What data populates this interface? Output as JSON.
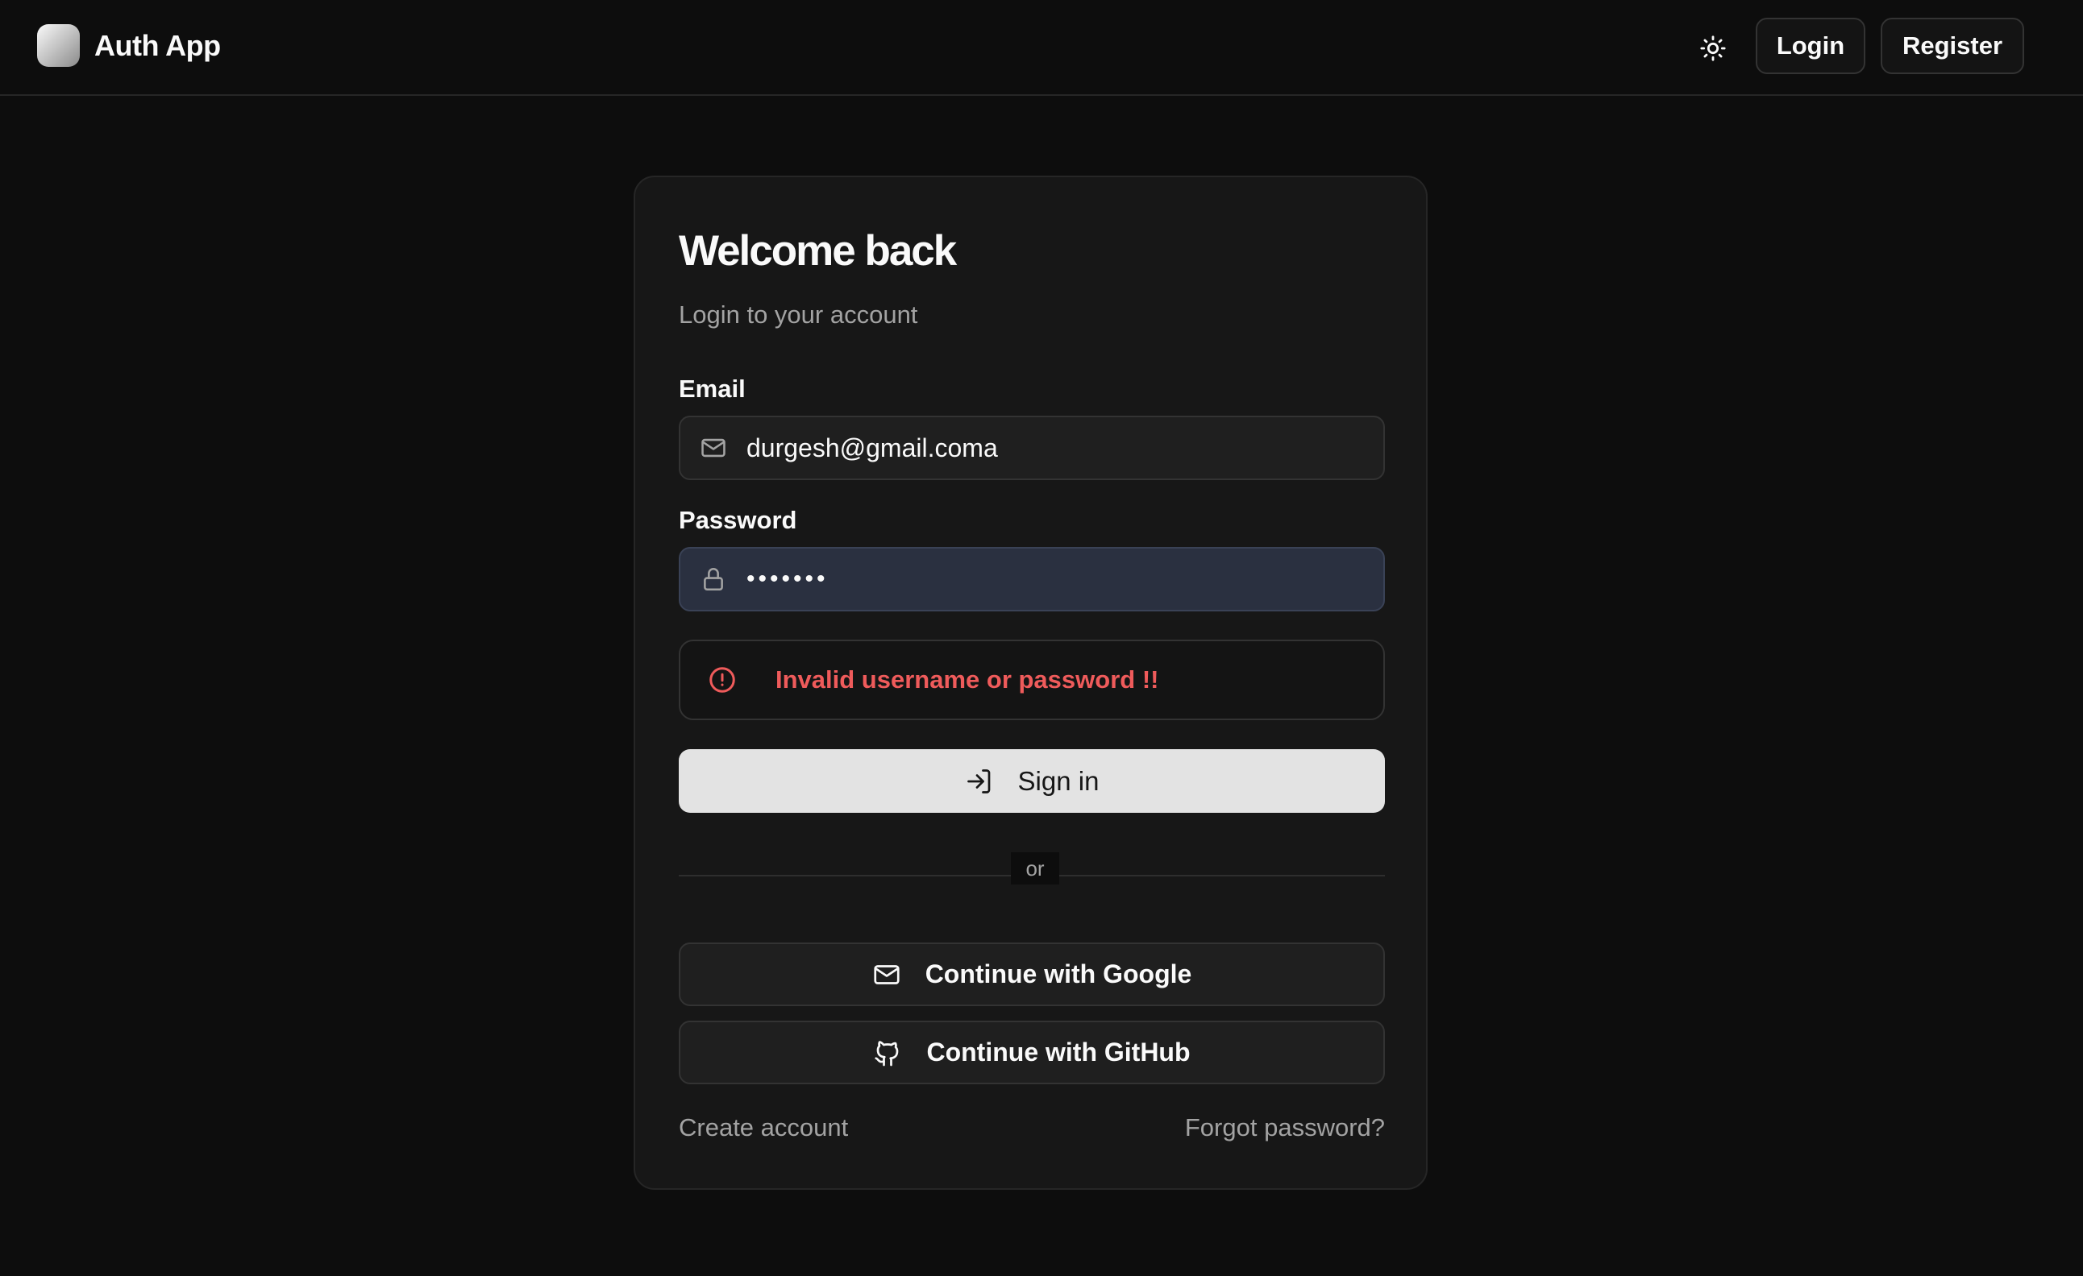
{
  "app": {
    "name": "Auth App",
    "logo_icon": "app-logo"
  },
  "nav": {
    "theme_toggle_icon": "sun-icon",
    "login_label": "Login",
    "register_label": "Register"
  },
  "login_card": {
    "title": "Welcome back",
    "subtitle": "Login to your account",
    "email": {
      "label": "Email",
      "icon": "mail-icon",
      "value": "durgesh@gmail.coma"
    },
    "password": {
      "label": "Password",
      "icon": "lock-icon",
      "value": "•••••••"
    },
    "error": {
      "icon": "alert-circle-icon",
      "message": "Invalid username or password !!",
      "color": "#ef5b5b"
    },
    "signin": {
      "icon": "log-in-icon",
      "label": "Sign in"
    },
    "divider_text": "or",
    "oauth": [
      {
        "icon": "mail-icon",
        "label": "Continue with Google"
      },
      {
        "icon": "github-icon",
        "label": "Continue with GitHub"
      }
    ],
    "links": {
      "create_account": "Create account",
      "forgot_password": "Forgot password?"
    }
  },
  "colors": {
    "background": "#0d0d0d",
    "card": "#171717",
    "primary_button": "#e3e3e3",
    "error": "#ef5b5b"
  }
}
